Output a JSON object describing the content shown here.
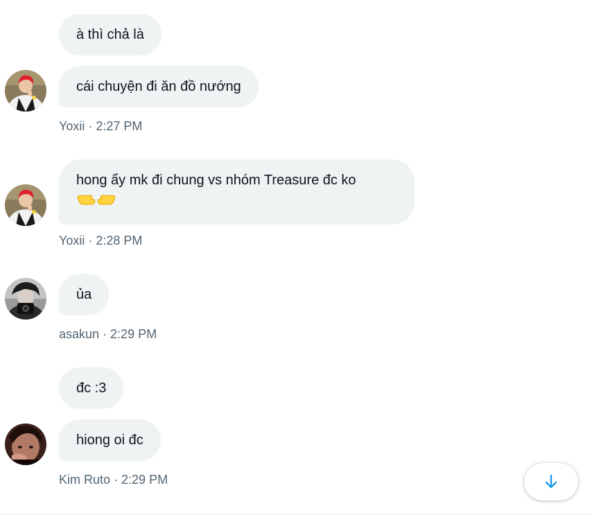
{
  "messages": [
    {
      "text": "à thì chả là"
    },
    {
      "text": "cái chuyện đi ăn đồ nướng"
    },
    {
      "text": "hong ấy mk đi chung vs nhóm Treasure đc ko"
    },
    {
      "text": "ủa"
    },
    {
      "text": "đc :3"
    },
    {
      "text": "hiong oi đc"
    }
  ],
  "meta": [
    {
      "author": "Yoxii",
      "separator": " · ",
      "time": "2:27 PM"
    },
    {
      "author": "Yoxii",
      "separator": " · ",
      "time": "2:28 PM"
    },
    {
      "author": "asakun",
      "separator": " · ",
      "time": "2:29 PM"
    },
    {
      "author": "Kim Ruto",
      "separator": " · ",
      "time": "2:29 PM"
    }
  ],
  "icons": {
    "emoji": "backhand-index-pointing-right-left-emoji",
    "scroll": "arrow-down-icon"
  },
  "colors": {
    "bubble": "#eff3f4",
    "text": "#0f1419",
    "meta": "#536471",
    "accent": "#1d9bf0"
  }
}
